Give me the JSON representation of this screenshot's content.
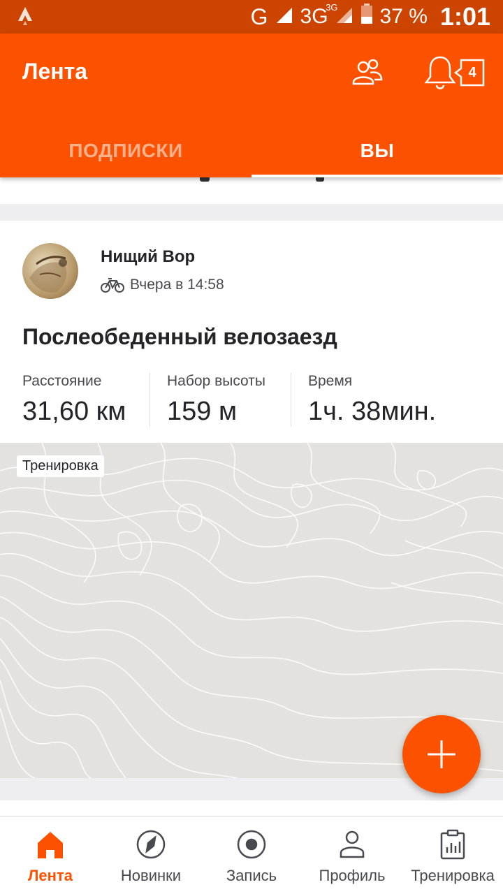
{
  "status_bar": {
    "network_type": "G",
    "network_3g": "3G",
    "network_3g_sup": "3G",
    "battery": "37 %",
    "time": "1:01"
  },
  "app_bar": {
    "title": "Лента",
    "notification_count": "4",
    "tabs": [
      {
        "label": "ПОДПИСКИ",
        "active": false
      },
      {
        "label": "ВЫ",
        "active": true
      }
    ]
  },
  "activity": {
    "athlete_name": "Нищий Вор",
    "activity_icon": "bike-icon",
    "timestamp": "Вчера в 14:58",
    "title": "Послеобеденный велозаезд",
    "stats": [
      {
        "label": "Расстояние",
        "value": "31,60 км"
      },
      {
        "label": "Набор высоты",
        "value": "159 м"
      },
      {
        "label": "Время",
        "value": "1ч. 38мин."
      }
    ],
    "map_tag": "Тренировка"
  },
  "bottom_nav": {
    "items": [
      {
        "label": "Лента",
        "icon": "home-icon",
        "active": true
      },
      {
        "label": "Новинки",
        "icon": "compass-icon",
        "active": false
      },
      {
        "label": "Запись",
        "icon": "record-icon",
        "active": false
      },
      {
        "label": "Профиль",
        "icon": "profile-icon",
        "active": false
      },
      {
        "label": "Тренировка",
        "icon": "clipboard-icon",
        "active": false
      }
    ]
  },
  "colors": {
    "brand": "#fc5200",
    "status_bar": "#cc4400"
  }
}
